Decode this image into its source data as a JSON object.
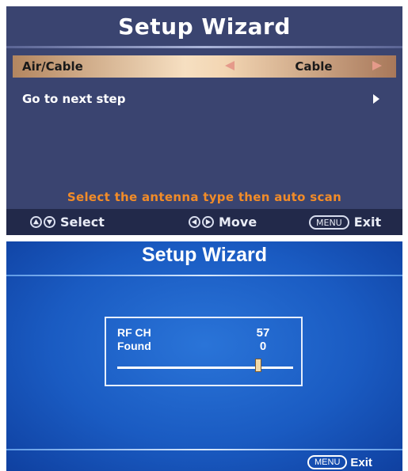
{
  "top": {
    "title": "Setup Wizard",
    "rows": [
      {
        "label": "Air/Cable",
        "value": "Cable",
        "selected": true
      },
      {
        "label": "Go to next step"
      }
    ],
    "hint": "Select the antenna type then auto scan",
    "hint_color": "#f28c28",
    "nav": {
      "select_label": "Select",
      "move_label": "Move",
      "menu_key": "MENU",
      "exit_label": "Exit"
    }
  },
  "bottom": {
    "title": "Setup Wizard",
    "scan": {
      "rf_ch_label": "RF CH",
      "rf_ch_value": "57",
      "found_label": "Found",
      "found_value": "0",
      "progress": 0.8
    },
    "nav": {
      "menu_key": "MENU",
      "exit_label": "Exit"
    }
  }
}
